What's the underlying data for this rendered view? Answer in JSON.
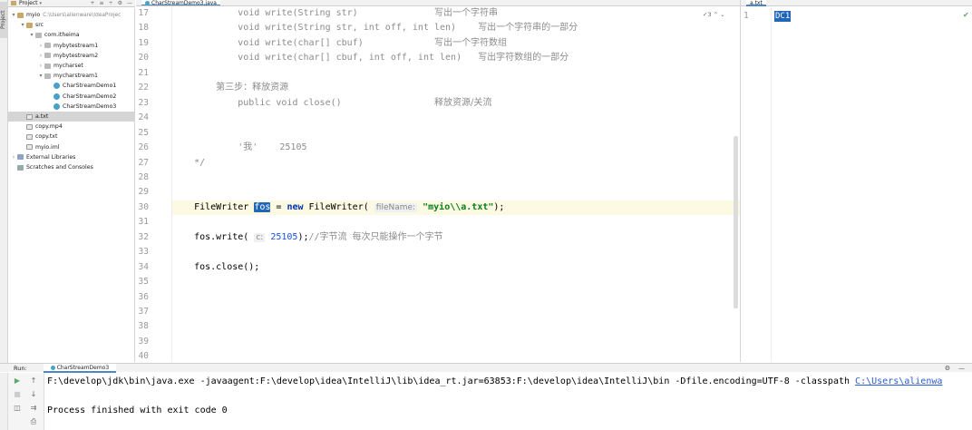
{
  "sidebar": {
    "stripe_label": "Project",
    "header_label": "Project",
    "header_tools": [
      "+",
      "≡",
      "÷",
      "⚙",
      "—"
    ],
    "tree": [
      {
        "label": "myio",
        "hint": "C:\\Users\\alienware\\IdeaProjec",
        "depth": 0,
        "arrow": "▾",
        "icon": "folder"
      },
      {
        "label": "src",
        "depth": 1,
        "arrow": "▾",
        "icon": "folder"
      },
      {
        "label": "com.itheima",
        "depth": 2,
        "arrow": "▾",
        "icon": "pkg"
      },
      {
        "label": "mybytestream1",
        "depth": 3,
        "arrow": "›",
        "icon": "pkg"
      },
      {
        "label": "mybytestream2",
        "depth": 3,
        "arrow": "›",
        "icon": "pkg"
      },
      {
        "label": "mycharset",
        "depth": 3,
        "arrow": "›",
        "icon": "pkg"
      },
      {
        "label": "mycharstream1",
        "depth": 3,
        "arrow": "▾",
        "icon": "pkg"
      },
      {
        "label": "CharStreamDemo1",
        "depth": 4,
        "arrow": "",
        "icon": "cls"
      },
      {
        "label": "CharStreamDemo2",
        "depth": 4,
        "arrow": "",
        "icon": "cls"
      },
      {
        "label": "CharStreamDemo3",
        "depth": 4,
        "arrow": "",
        "icon": "cls"
      },
      {
        "label": "a.txt",
        "depth": 1,
        "arrow": "",
        "icon": "file",
        "selected": true
      },
      {
        "label": "copy.mp4",
        "depth": 1,
        "arrow": "",
        "icon": "file"
      },
      {
        "label": "copy.txt",
        "depth": 1,
        "arrow": "",
        "icon": "file"
      },
      {
        "label": "myio.iml",
        "depth": 1,
        "arrow": "",
        "icon": "file"
      },
      {
        "label": "External Libraries",
        "depth": 0,
        "arrow": "›",
        "icon": "lib"
      },
      {
        "label": "Scratches and Consoles",
        "depth": 0,
        "arrow": "",
        "icon": "scr"
      }
    ]
  },
  "editor": {
    "tab_label": "CharStreamDemo3.java",
    "badge": "✓3 ⌃ ⌄",
    "lines": [
      {
        "n": "17",
        "html": "            void write(String str)              写出一个字符串"
      },
      {
        "n": "18",
        "html": "            void write(String str, int off, int len)    写出一个字符串的一部分"
      },
      {
        "n": "19",
        "html": "            void write(char[] cbuf)             写出一个字符数组"
      },
      {
        "n": "20",
        "html": "            void write(char[] cbuf, int off, int len)   写出字符数组的一部分"
      },
      {
        "n": "21",
        "html": ""
      },
      {
        "n": "22",
        "html": "        第三步：释放资源"
      },
      {
        "n": "23",
        "html": "            public void close()                 释放资源/关流"
      },
      {
        "n": "24",
        "html": ""
      },
      {
        "n": "25",
        "html": ""
      },
      {
        "n": "26",
        "html": "            '我'    25105"
      },
      {
        "n": "27",
        "html": "    */"
      },
      {
        "n": "28",
        "html": ""
      },
      {
        "n": "29",
        "html": ""
      },
      {
        "n": "30",
        "html": "    FileWriter fos = new FileWriter( fileName: \"myio\\\\a.txt\");"
      },
      {
        "n": "31",
        "html": ""
      },
      {
        "n": "32",
        "html": "    fos.write( c: 25105);//字节流 每次只能操作一个字节"
      },
      {
        "n": "33",
        "html": ""
      },
      {
        "n": "34",
        "html": "    fos.close();"
      },
      {
        "n": "35",
        "html": ""
      },
      {
        "n": "36",
        "html": ""
      },
      {
        "n": "37",
        "html": ""
      },
      {
        "n": "38",
        "html": ""
      },
      {
        "n": "39",
        "html": ""
      },
      {
        "n": "40",
        "html": ""
      }
    ]
  },
  "right_panel": {
    "tab_label": "a.txt",
    "line_number": "1",
    "content": "DC1",
    "status_icon": "check-icon"
  },
  "run": {
    "label": "Run:",
    "tab_label": "CharStreamDemo3",
    "console": {
      "cmd_prefix": "F:\\develop\\jdk\\bin\\java.exe -javaagent:F:\\develop\\idea\\IntelliJ\\lib\\idea_rt.jar=63853:F:\\develop\\idea\\IntelliJ\\bin -Dfile.encoding=UTF-8 -classpath ",
      "cmd_link": "C:\\Users\\alienwa",
      "exit_line": "Process finished with exit code 0"
    }
  }
}
